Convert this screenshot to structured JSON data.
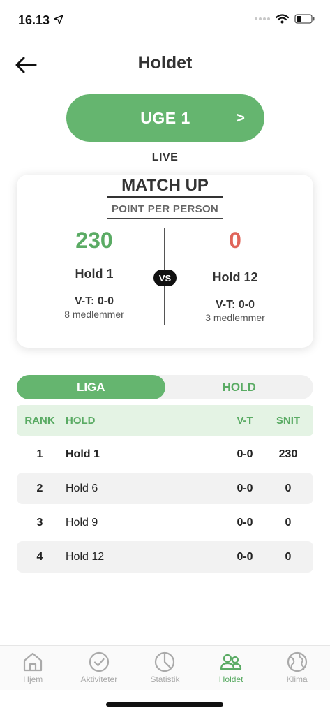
{
  "status_bar": {
    "time": "16.13"
  },
  "header": {
    "title": "Holdet"
  },
  "week_button": {
    "label": "UGE 1",
    "chevron": ">"
  },
  "live_label": "LIVE",
  "matchup": {
    "title": "MATCH UP",
    "subtitle": "POINT PER PERSON",
    "vs": "VS",
    "left": {
      "score": "230",
      "name": "Hold 1",
      "record": "V-T: 0-0",
      "members": "8 medlemmer"
    },
    "right": {
      "score": "0",
      "name": "Hold 12",
      "record": "V-T: 0-0",
      "members": "3 medlemmer"
    }
  },
  "tabs": [
    {
      "label": "LIGA"
    },
    {
      "label": "HOLD"
    }
  ],
  "table": {
    "headers": {
      "rank": "RANK",
      "hold": "HOLD",
      "vt": "V-T",
      "snit": "SNIT"
    },
    "rows": [
      {
        "rank": "1",
        "hold": "Hold 1",
        "vt": "0-0",
        "snit": "230"
      },
      {
        "rank": "2",
        "hold": "Hold 6",
        "vt": "0-0",
        "snit": "0"
      },
      {
        "rank": "3",
        "hold": "Hold 9",
        "vt": "0-0",
        "snit": "0"
      },
      {
        "rank": "4",
        "hold": "Hold 12",
        "vt": "0-0",
        "snit": "0"
      }
    ]
  },
  "nav": [
    {
      "label": "Hjem",
      "icon": "home-icon"
    },
    {
      "label": "Aktiviteter",
      "icon": "check-circle-icon"
    },
    {
      "label": "Statistik",
      "icon": "pie-chart-icon"
    },
    {
      "label": "Holdet",
      "icon": "team-icon"
    },
    {
      "label": "Klima",
      "icon": "globe-icon"
    }
  ],
  "colors": {
    "accent": "#65b56f",
    "score_positive": "#5aab64",
    "score_negative": "#e0655a"
  }
}
